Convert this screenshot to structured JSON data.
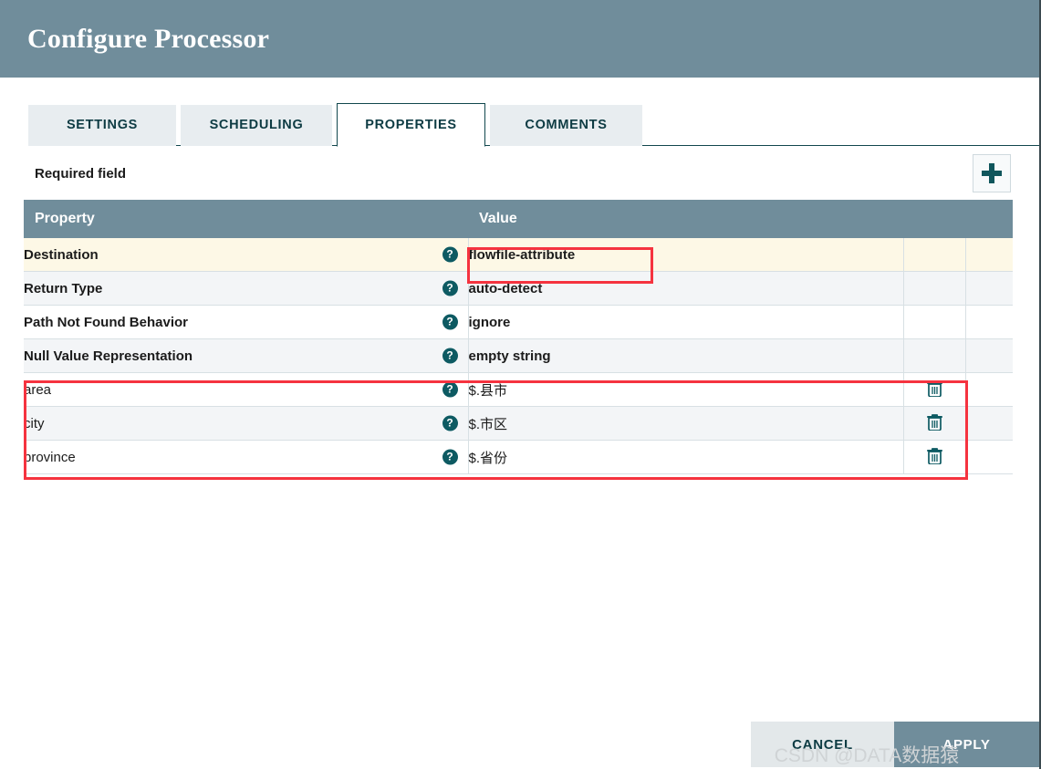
{
  "dialog": {
    "title": "Configure Processor"
  },
  "tabs": [
    {
      "label": "SETTINGS",
      "active": false
    },
    {
      "label": "SCHEDULING",
      "active": false
    },
    {
      "label": "PROPERTIES",
      "active": true
    },
    {
      "label": "COMMENTS",
      "active": false
    }
  ],
  "subhead": {
    "required_label": "Required field",
    "add_button_icon": "plus-icon"
  },
  "table": {
    "columns": [
      "Property",
      "Value"
    ],
    "help_icon": "help-circle-icon",
    "delete_icon": "trash-icon",
    "rows": [
      {
        "property": "Destination",
        "value": "flowfile-attribute",
        "required": true,
        "deletable": false,
        "row_bg": "cream"
      },
      {
        "property": "Return Type",
        "value": "auto-detect",
        "required": true,
        "deletable": false,
        "row_bg": "gray"
      },
      {
        "property": "Path Not Found Behavior",
        "value": "ignore",
        "required": true,
        "deletable": false,
        "row_bg": "white"
      },
      {
        "property": "Null Value Representation",
        "value": "empty string",
        "required": true,
        "deletable": false,
        "row_bg": "gray"
      },
      {
        "property": "area",
        "value": "$.县市",
        "required": false,
        "deletable": true,
        "row_bg": "white"
      },
      {
        "property": "city",
        "value": "$.市区",
        "required": false,
        "deletable": true,
        "row_bg": "gray"
      },
      {
        "property": "province",
        "value": "$.省份",
        "required": false,
        "deletable": true,
        "row_bg": "white"
      }
    ]
  },
  "footer": {
    "cancel_label": "CANCEL",
    "apply_label": "APPLY"
  },
  "watermark": {
    "text": "CSDN @DATA数据猿"
  },
  "colors": {
    "header_bg": "#708d9b",
    "table_header_bg": "#708d9b",
    "accent_teal": "#0d5a62",
    "annotation_red": "#f5333f",
    "required_row_bg": "#fdf8e6",
    "alt_row_bg": "#f3f5f7",
    "apply_bg": "#708d9b",
    "cancel_bg": "#e3e8ea"
  }
}
